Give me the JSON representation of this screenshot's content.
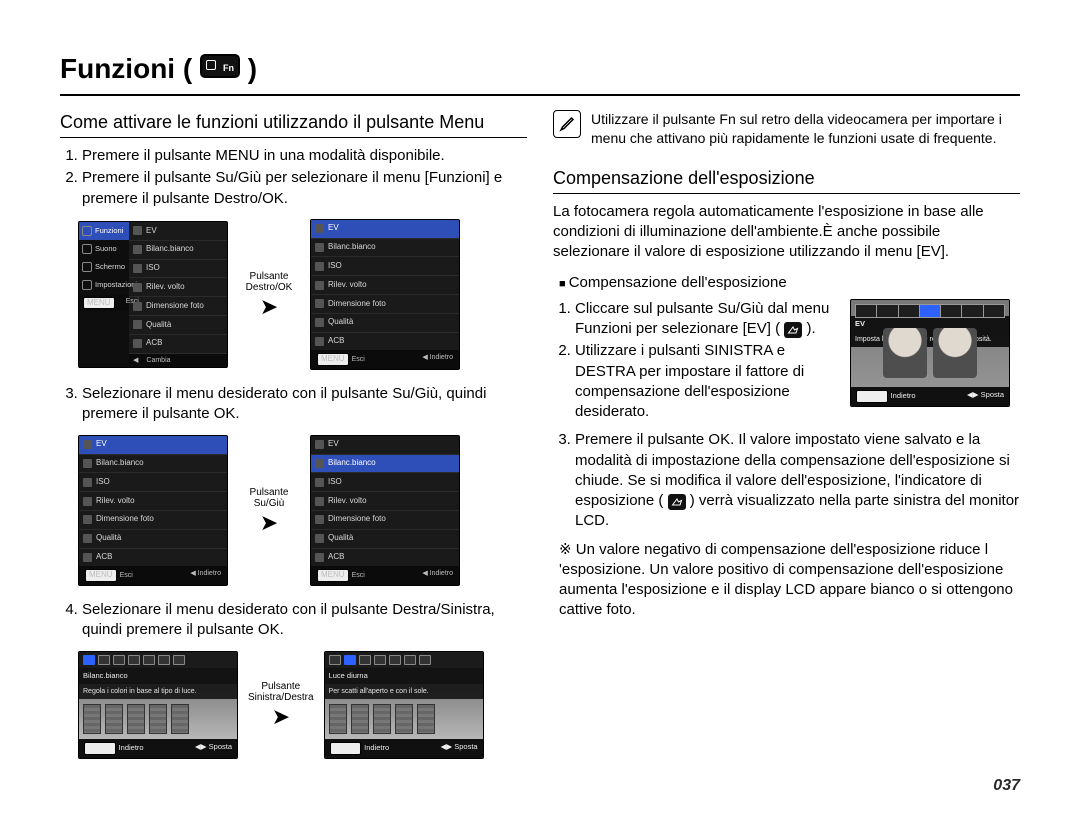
{
  "page_number": "037",
  "title_prefix": "Funzioni (",
  "title_suffix": " )",
  "fn_icon_label": "Fn",
  "tip_text": "Utilizzare il pulsante Fn sul retro della videocamera per importare i menu che attivano più rapidamente le funzioni usate di frequente.",
  "left": {
    "heading": "Come attivare le funzioni utilizzando il pulsante Menu",
    "step1": "Premere il pulsante MENU in una modalità disponibile.",
    "step2": "Premere il pulsante Su/Giù per selezionare il menu [Funzioni] e premere il pulsante Destro/OK.",
    "step3": "Selezionare il menu desiderato con il pulsante Su/Giù, quindi premere il pulsante OK.",
    "step4": "Selezionare il menu desiderato con il pulsante Destra/Sinistra, quindi premere il pulsante OK.",
    "labels": {
      "destro_ok": "Pulsante\nDestro/OK",
      "su_giu": "Pulsante\nSu/Giù",
      "sx_dx": "Pulsante\nSinistra/Destra"
    },
    "menu": {
      "side": {
        "funzioni": "Funzioni",
        "suono": "Suono",
        "schermo": "Schermo",
        "impostazioni": "Impostazioni"
      },
      "items": {
        "ev": "EV",
        "bilanc": "Bilanc.bianco",
        "iso": "ISO",
        "rilev": "Rilev. volto",
        "dimfoto": "Dimensione foto",
        "qualita": "Qualità",
        "acb": "ACB"
      },
      "footer": {
        "esci": "Esci",
        "cambia": "Cambia",
        "indietro": "Indietro"
      }
    },
    "preview": {
      "row1_title": "Bilanc.bianco",
      "row1_sub": "Regola i colori in base al tipo di luce.",
      "row2_title": "Luce diurna",
      "row2_sub": "Per scatti all'aperto e con il sole.",
      "footer_back": "Indietro",
      "footer_move": "Sposta"
    }
  },
  "right": {
    "heading": "Compensazione dell'esposizione",
    "intro": "La fotocamera regola automaticamente l'esposizione in base alle condizioni di illuminazione dell'ambiente.È anche possibile selezionare il valore di esposizione utilizzando il menu [EV].",
    "bullet": "Compensazione dell'esposizione",
    "step1a": "Cliccare sul pulsante Su/Giù dal menu Funzioni per selezionare [EV] ( ",
    "step1b": " ).",
    "step2": "Utilizzare i pulsanti SINISTRA e DESTRA per impostare il fattore di compensazione dell'esposizione desiderato.",
    "step3a": "Premere il pulsante OK. Il valore impostato viene salvato e la modalità di impostazione della compensazione dell'esposizione si chiude. Se si modifica il valore dell'esposizione, l'indicatore di esposizione ( ",
    "step3b": " ) verrà visualizzato nella parte sinistra del monitor LCD.",
    "note": "Un valore negativo di compensazione dell'esposizione riduce l 'esposizione. Un valore positivo di compensazione dell'esposizione aumenta l'esposizione e il display LCD appare bianco o si ottengono cattive foto.",
    "ev_screen": {
      "title": "EV",
      "sub": "Imposta l'esposizione e regola la luminosità.",
      "back": "Indietro",
      "move": "Sposta"
    }
  }
}
